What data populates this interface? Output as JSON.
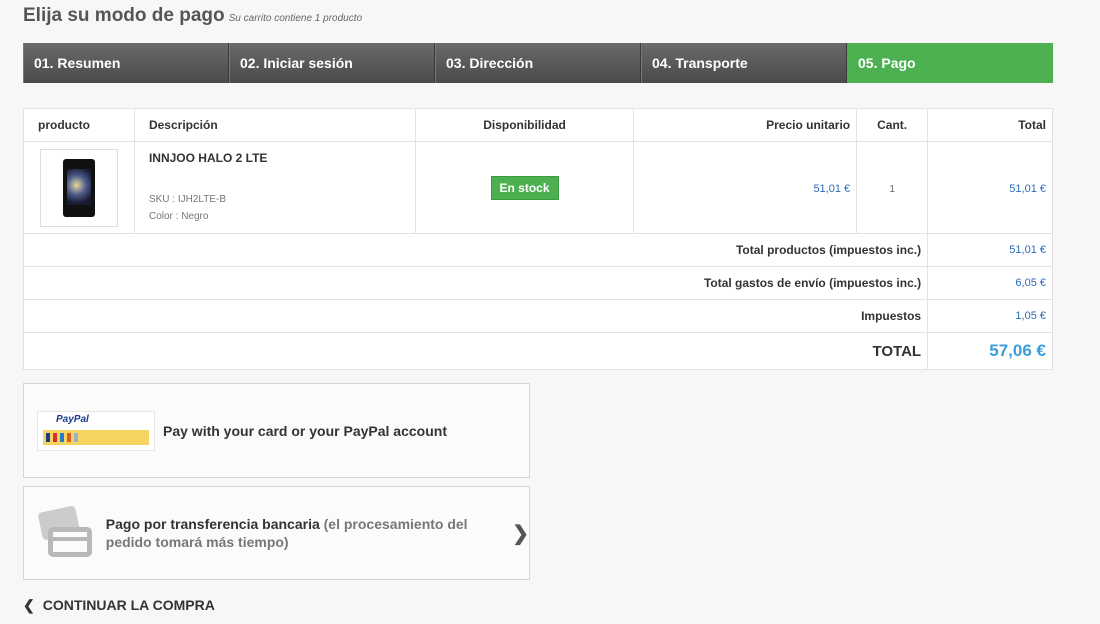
{
  "heading": {
    "title": "Elija su modo de pago",
    "subtitle": "Su carrito contiene 1 producto"
  },
  "steps": [
    {
      "label": "01. Resumen"
    },
    {
      "label": "02. Iniciar sesión"
    },
    {
      "label": "03. Dirección"
    },
    {
      "label": "04. Transporte"
    },
    {
      "label": "05. Pago"
    }
  ],
  "cart": {
    "headers": {
      "product": "producto",
      "description": "Descripción",
      "availability": "Disponibilidad",
      "unit_price": "Precio unitario",
      "qty": "Cant.",
      "total": "Total"
    },
    "item": {
      "name": "INNJOO HALO 2 LTE",
      "sku": "SKU : IJH2LTE-B",
      "color": "Color : Negro",
      "availability": "En stock",
      "unit_price": "51,01 €",
      "qty": "1",
      "total": "51,01 €"
    },
    "summary": [
      {
        "label": "Total productos (impuestos inc.)",
        "value": "51,01 €"
      },
      {
        "label": "Total gastos de envío (impuestos inc.)",
        "value": "6,05 €"
      },
      {
        "label": "Impuestos",
        "value": "1,05 €"
      }
    ],
    "grand_total": {
      "label": "TOTAL",
      "value": "57,06 €"
    }
  },
  "payment": {
    "paypal": {
      "logo_word": "PayPal",
      "label": "Pay with your card or your PayPal account"
    },
    "bank": {
      "label": "Pago por transferencia bancaria",
      "note": "(el procesamiento del pedido tomará más tiempo)"
    }
  },
  "continue_label": "CONTINUAR LA COMPRA",
  "colors": {
    "accent_green": "#4cb050",
    "price_blue": "#2a6ab8",
    "total_blue": "#3a9ed8"
  }
}
